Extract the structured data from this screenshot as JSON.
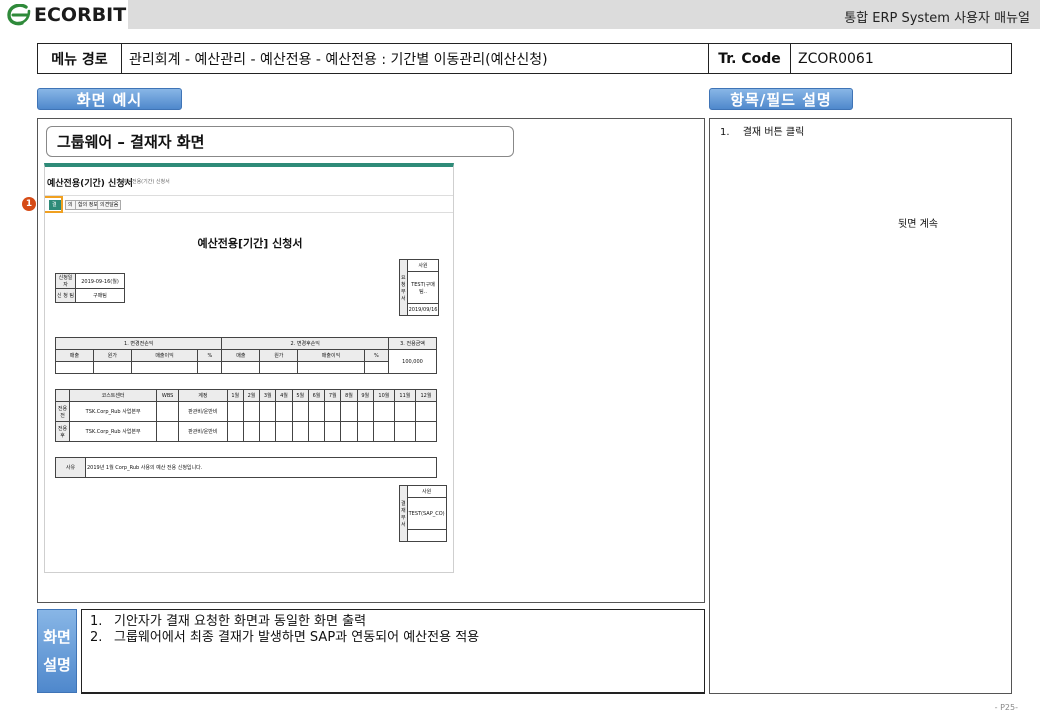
{
  "header": {
    "brand": "ECORBIT",
    "title": "통합 ERP System 사용자 매뉴얼"
  },
  "path": {
    "menu_label": "메뉴 경로",
    "menu_value": "관리회계 - 예산관리 - 예산전용 - 예산전용 : 기간별 이동관리(예산신청)",
    "code_label": "Tr. Code",
    "code_value": "ZCOR0061"
  },
  "tabs": {
    "screen_example": "화면 예시",
    "field_desc": "항목/필드 설명"
  },
  "main": {
    "subtitle": "그룹웨어 – 결재자 화면"
  },
  "screenshot": {
    "title": "예산전용(기간) 신청서",
    "crumb": "> 예산전용(기간) 신청서",
    "buttons": [
      "결재",
      "의",
      "합의 정보",
      "의견달음"
    ],
    "badge": "1",
    "form_title": "예산전용[기간] 신청서",
    "apply_date_label": "신청일자",
    "apply_date_value": "2019-09-16(월)",
    "applicant_label": "신 청 팀",
    "applicant_value": "구매팀",
    "sign_top_head": "사원",
    "sign_top_side": "요청부서",
    "sign_top_name": "TEST(구매팀..",
    "sign_top_date": "2019/09/16",
    "sec1": "1. 변경전손익",
    "sec2": "2. 변경후손익",
    "sec3": "3. 전용금액",
    "col_sales": "매출",
    "col_cost": "원가",
    "col_profit": "매출이익",
    "col_pct": "%",
    "transfer_amount": "100,000",
    "grid_head": [
      "코스트센터",
      "WBS",
      "계정",
      "1월",
      "2월",
      "3월",
      "4월",
      "5월",
      "6월",
      "7월",
      "8월",
      "9월",
      "10월",
      "11월",
      "12월"
    ],
    "row_before_label": "전용 전",
    "row_after_label": "전용 후",
    "row_cc": "TSK.Corp_Rub 사업본부",
    "row_account": "판관비/운반비",
    "reason_label": "사유",
    "reason_value": "2019년 1월 Corp_Rub 사용의 예산 전용 신청입니다.",
    "sign_bot_head": "사원",
    "sign_bot_side": "결재부서",
    "sign_bot_name": "TEST(SAP_CO)"
  },
  "right": {
    "item1_num": "1.",
    "item1_text": "결재 버튼 클릭",
    "continued": "뒷면 계속"
  },
  "desc": {
    "tab_line1": "화면",
    "tab_line2": "설명",
    "lines": [
      {
        "num": "1.",
        "text": "기안자가 결재 요청한 화면과 동일한 화면 출력"
      },
      {
        "num": "2.",
        "text": "그룹웨어에서 최종 결재가 발생하면 SAP과 연동되어 예산전용 적용"
      }
    ]
  },
  "page_number": "- P25-",
  "colors": {
    "tab_blue": "#4f88cc",
    "highlight_orange": "#f0a020",
    "badge_red": "#d64b16",
    "shot_green": "#2e8b78"
  }
}
